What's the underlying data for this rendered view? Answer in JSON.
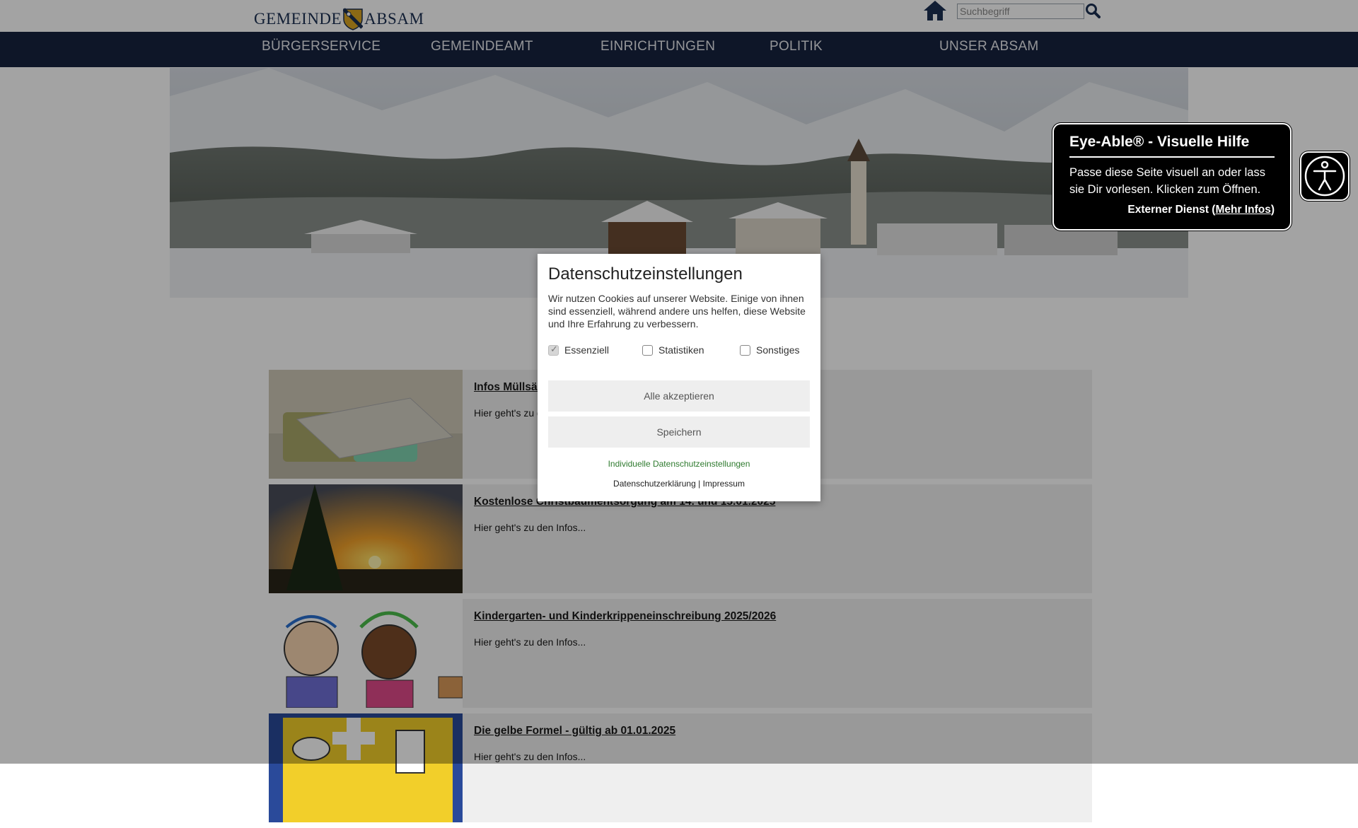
{
  "header": {
    "logo_text_left": "GEMEINDE",
    "logo_text_right": "ABSAM",
    "search_placeholder": "Suchbegriff"
  },
  "nav": {
    "items": [
      {
        "label": "BÜRGERSERVICE"
      },
      {
        "label": "GEMEINDEAMT"
      },
      {
        "label": "EINRICHTUNGEN"
      },
      {
        "label": "POLITIK"
      },
      {
        "label": "UNSER ABSAM"
      }
    ]
  },
  "news": {
    "items": [
      {
        "title": "Infos Müllsäcke",
        "subtitle": "Hier geht's zu den Infos..."
      },
      {
        "title": "Kostenlose Christbaumentsorgung am 14. und 15.01.2025",
        "subtitle": "Hier geht's zu den Infos..."
      },
      {
        "title": "Kindergarten- und Kinderkrippeneinschreibung 2025/2026",
        "subtitle": "Hier geht's zu den Infos..."
      },
      {
        "title": "Die gelbe Formel - gültig ab 01.01.2025",
        "subtitle": "Hier geht's zu den Infos..."
      }
    ]
  },
  "cookie_modal": {
    "title": "Datenschutzeinstellungen",
    "text": "Wir nutzen Cookies auf unserer Website. Einige von ihnen sind essenziell, während andere uns helfen, diese Website und Ihre Erfahrung zu verbessern.",
    "options": [
      {
        "label": "Essenziell",
        "checked": true,
        "disabled": true
      },
      {
        "label": "Statistiken",
        "checked": false
      },
      {
        "label": "Sonstiges",
        "checked": false
      }
    ],
    "accept_all_label": "Alle akzeptieren",
    "save_label": "Speichern",
    "individual_link": "Individuelle Datenschutzeinstellungen",
    "privacy_link": "Datenschutzerklärung",
    "separator": "|",
    "imprint_link": "Impressum"
  },
  "eye_able": {
    "title": "Eye-Able® - Visuelle Hilfe",
    "description": "Passe diese Seite visuell an oder lass sie Dir vorlesen. Klicken zum Öffnen.",
    "external_prefix": "Externer Dienst (",
    "more_info": "Mehr Infos",
    "external_suffix": ")"
  },
  "colors": {
    "nav_bg": "#16233f",
    "nav_text": "#e8eaee",
    "link_green": "#2e7a2e",
    "modal_button_bg": "#eeeeee"
  }
}
